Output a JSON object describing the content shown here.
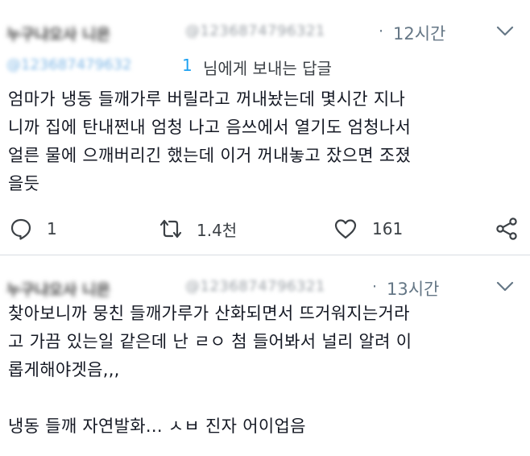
{
  "tweets": [
    {
      "author_name": "누구냐오사 니은",
      "author_handle": "@1236874796321",
      "dot": "·",
      "time": "12시간",
      "reply_handle": "@123687479632",
      "reply_handle_tail": "1",
      "reply_text": "님에게 보내는 답글",
      "body": "엄마가 냉동 들깨가루 버릴라고 꺼내놨는데 몇시간 지나\n니까 집에 탄내쩐내 엄청 나고 음쓰에서 열기도 엄청나서\n얼른 물에 으깨버리긴 했는데 이거 꺼내놓고 잤으면 조졌\n을듯",
      "replies": "1",
      "retweets": "1.4천",
      "likes": "161"
    },
    {
      "author_name": "누구냐오사 니은",
      "author_handle": "@1236874796321",
      "dot": "·",
      "time": "13시간",
      "body": "찾아보니까 뭉친 들깨가루가 산화되면서 뜨거워지는거라\n고 가끔 있는일 같은데 난 ㄹㅇ 첨 들어봐서 널리 알려 이\n롭게해야겟음,,,\n\n냉동 들깨 자연발화... ㅅㅂ 진자 어이업음"
    }
  ],
  "colors": {
    "link": "#1da1f2",
    "muted": "#657786",
    "text": "#141823"
  },
  "icons": [
    "reply-icon",
    "retweet-icon",
    "like-icon",
    "share-icon",
    "chevron-down-icon"
  ]
}
